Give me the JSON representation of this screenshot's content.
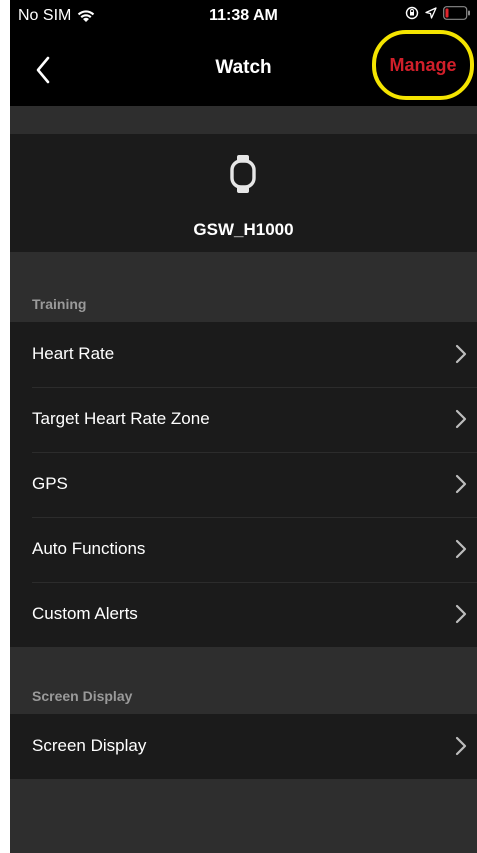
{
  "status_bar": {
    "carrier": "No SIM",
    "time": "11:38 AM"
  },
  "nav": {
    "title": "Watch",
    "manage_label": "Manage"
  },
  "device": {
    "name": "GSW_H1000",
    "icon": "watch-icon"
  },
  "sections": [
    {
      "header": "Training",
      "items": [
        {
          "label": "Heart Rate"
        },
        {
          "label": "Target Heart Rate Zone"
        },
        {
          "label": "GPS"
        },
        {
          "label": "Auto Functions"
        },
        {
          "label": "Custom Alerts"
        }
      ]
    },
    {
      "header": "Screen Display",
      "items": [
        {
          "label": "Screen Display"
        }
      ]
    }
  ],
  "colors": {
    "accent": "#d11f2a",
    "highlight": "#f4e400",
    "row_bg": "#1b1b1b",
    "section_bg": "#2e2e2e",
    "header_text": "#9a9a9a"
  }
}
